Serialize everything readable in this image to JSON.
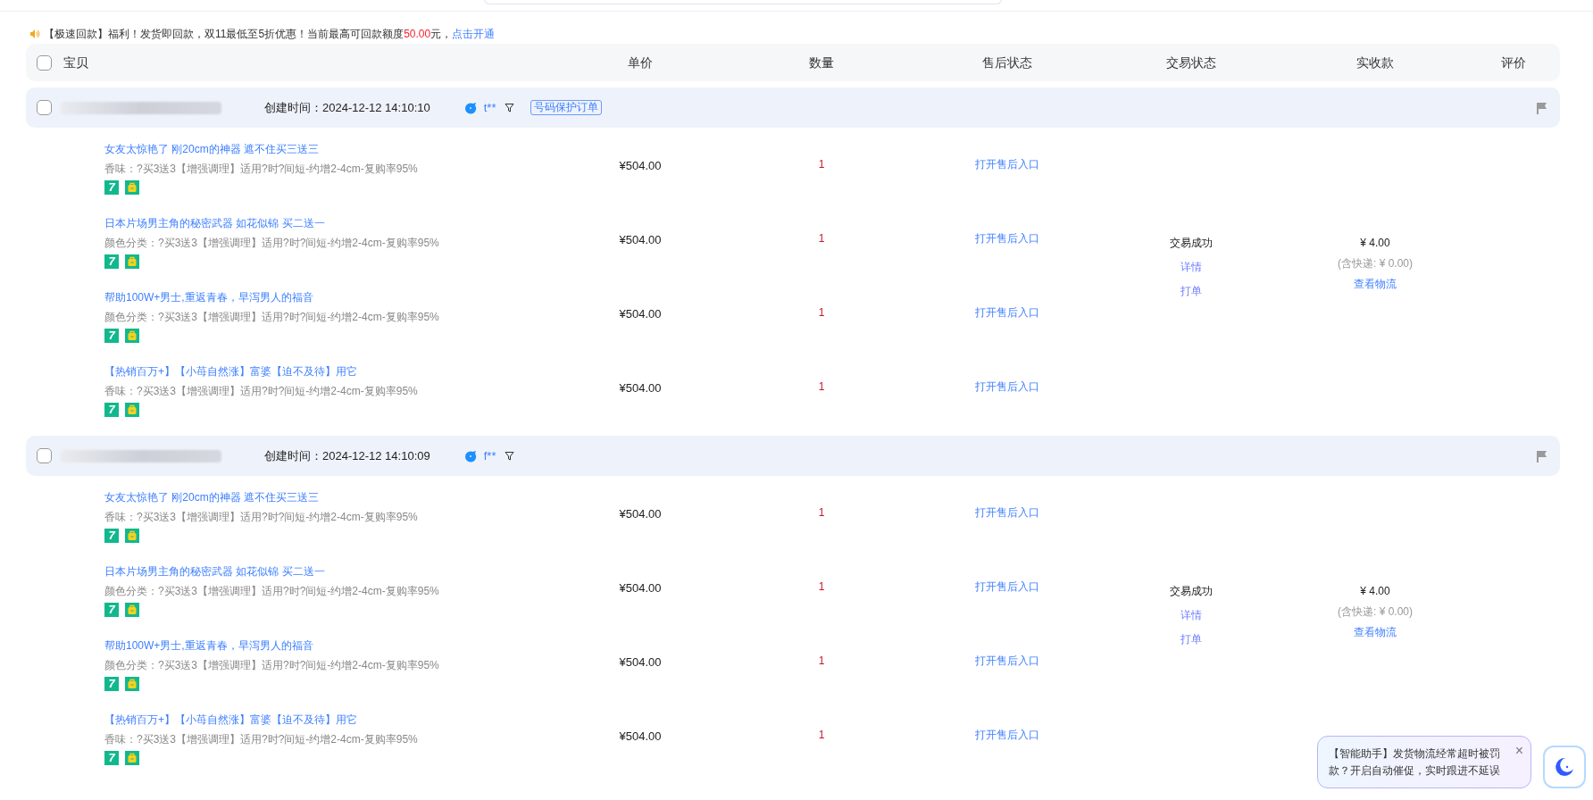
{
  "notice": {
    "text": "【极速回款】福利！发货即回款，双11最低至5折优惠！当前最高可回款额度",
    "amount": "50.00",
    "suffix": "元，",
    "link": "点击开通"
  },
  "header": {
    "checked": false,
    "columns": [
      "宝贝",
      "单价",
      "数量",
      "售后状态",
      "交易状态",
      "实收款",
      "评价"
    ]
  },
  "orders": [
    {
      "checked": false,
      "created": "创建时间：2024-12-12 14:10:10",
      "buyer": "t**",
      "tag": "号码保护订单",
      "trade_status": "交易成功",
      "actions": [
        "详情",
        "打单"
      ],
      "amount": "¥ 4.00",
      "shipping": "(含快递: ¥ 0.00)",
      "logistics": "查看物流",
      "items": [
        {
          "title": "女友太惊艳了 刚20cm的神器 遮不住买三送三",
          "sku": "香味：?买3送3【增强调理】适用?时?间短-约增2-4cm-复购率95%",
          "badge": "7",
          "price": "¥504.00",
          "qty": "1",
          "after_sale": "打开售后入口"
        },
        {
          "title": "日本片场男主角的秘密武器 如花似锦 买二送一",
          "sku": "颜色分类：?买3送3【增强调理】适用?时?间短-约增2-4cm-复购率95%",
          "badge": "7",
          "price": "¥504.00",
          "qty": "1",
          "after_sale": "打开售后入口"
        },
        {
          "title": "帮助100W+男士,重返青春，早泻男人的福音",
          "sku": "颜色分类：?买3送3【增强调理】适用?时?间短-约增2-4cm-复购率95%",
          "badge": "7",
          "price": "¥504.00",
          "qty": "1",
          "after_sale": "打开售后入口"
        },
        {
          "title": "【热销百万+】【小苺自然涨】富婆【迫不及待】用它",
          "sku": "香味：?买3送3【增强调理】适用?时?间短-约增2-4cm-复购率95%",
          "badge": "7",
          "price": "¥504.00",
          "qty": "1",
          "after_sale": "打开售后入口"
        }
      ]
    },
    {
      "checked": false,
      "created": "创建时间：2024-12-12 14:10:09",
      "buyer": "f**",
      "trade_status": "交易成功",
      "actions": [
        "详情",
        "打单"
      ],
      "amount": "¥ 4.00",
      "shipping": "(含快递: ¥ 0.00)",
      "logistics": "查看物流",
      "items": [
        {
          "title": "女友太惊艳了 刚20cm的神器 遮不住买三送三",
          "sku": "香味：?买3送3【增强调理】适用?时?间短-约增2-4cm-复购率95%",
          "badge": "7",
          "price": "¥504.00",
          "qty": "1",
          "after_sale": "打开售后入口"
        },
        {
          "title": "日本片场男主角的秘密武器 如花似锦 买二送一",
          "sku": "颜色分类：?买3送3【增强调理】适用?时?间短-约增2-4cm-复购率95%",
          "badge": "7",
          "price": "¥504.00",
          "qty": "1",
          "after_sale": "打开售后入口"
        },
        {
          "title": "帮助100W+男士,重返青春，早泻男人的福音",
          "sku": "颜色分类：?买3送3【增强调理】适用?时?间短-约增2-4cm-复购率95%",
          "badge": "7",
          "price": "¥504.00",
          "qty": "1",
          "after_sale": "打开售后入口"
        },
        {
          "title": "【热销百万+】【小苺自然涨】富婆【迫不及待】用它",
          "sku": "香味：?买3送3【增强调理】适用?时?间短-约增2-4cm-复购率95%",
          "badge": "7",
          "price": "¥504.00",
          "qty": "1",
          "after_sale": "打开售后入口"
        }
      ]
    }
  ],
  "assistant": {
    "message": "【智能助手】发货物流经常超时被罚款？开启自动催促，实时跟进不延误",
    "close": "×"
  }
}
